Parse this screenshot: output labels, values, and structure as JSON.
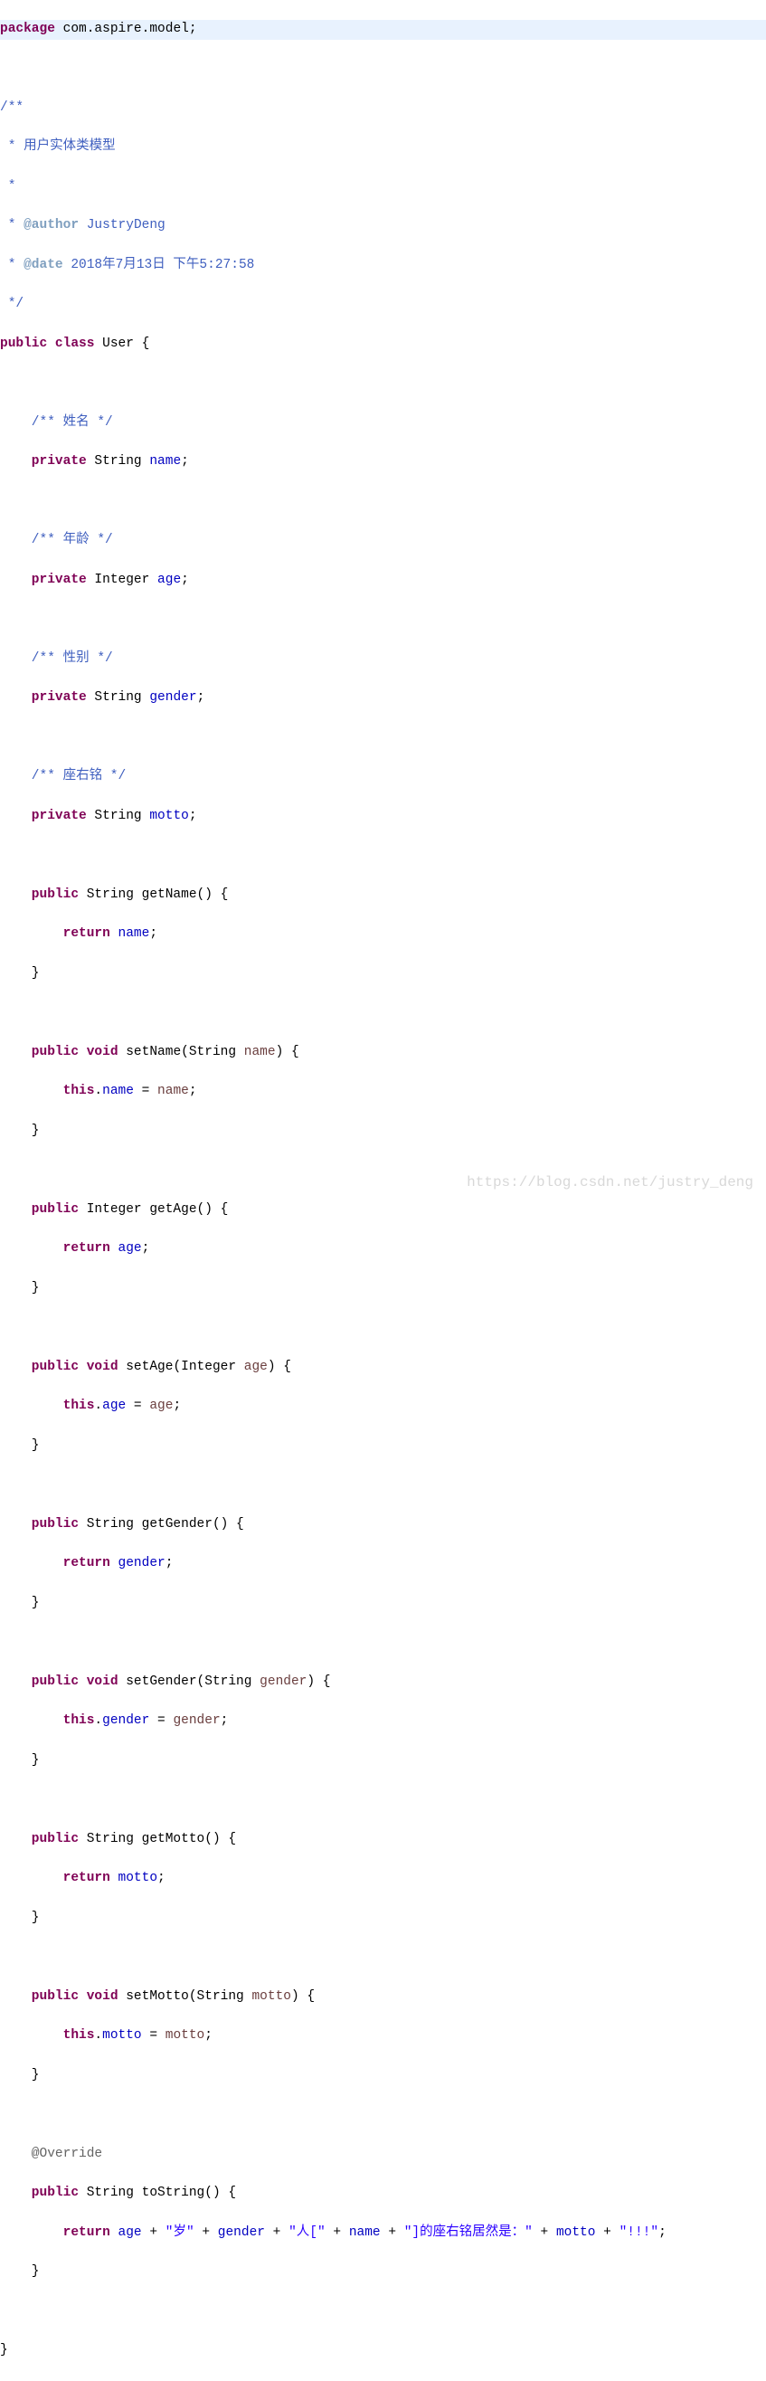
{
  "pkg": {
    "kw": "package",
    "name": " com.aspire.model;"
  },
  "javadoc": {
    "l1": "/**",
    "l2": " * 用户实体类模型",
    "l3": " * ",
    "l4a": " * ",
    "l4tag": "@author",
    "l4b": " JustryDeng",
    "l5a": " * ",
    "l5tag": "@date",
    "l5b": " 2018年7月13日 下午5:27:58",
    "l6": " */"
  },
  "cls": {
    "pub": "public",
    "class": "class",
    "name": " User {"
  },
  "f_name": {
    "c": "    /** 姓名 */",
    "kw": "    private",
    "type": " String ",
    "field": "name",
    "semi": ";"
  },
  "f_age": {
    "c": "    /** 年龄 */",
    "kw": "    private",
    "type": " Integer ",
    "field": "age",
    "semi": ";"
  },
  "f_gender": {
    "c": "    /** 性别 */",
    "kw": "    private",
    "type": " String ",
    "field": "gender",
    "semi": ";"
  },
  "f_motto": {
    "c": "    /** 座右铭 */",
    "kw": "    private",
    "type": " String ",
    "field": "motto",
    "semi": ";"
  },
  "getName": {
    "sig_pub": "    public",
    "sig_rest": " String getName() {",
    "ret_kw": "        return",
    "ret_sp": " ",
    "ret_field": "name",
    "ret_semi": ";",
    "close": "    }"
  },
  "setName": {
    "sig_pub": "    public",
    "sig_void": " void",
    "sig_rest_a": " setName(String ",
    "sig_param": "name",
    "sig_rest_b": ") {",
    "body_this": "        this",
    "body_dot": ".",
    "body_field": "name",
    "body_eq": " = ",
    "body_param": "name",
    "body_semi": ";",
    "close": "    }"
  },
  "getAge": {
    "sig_pub": "    public",
    "sig_rest": " Integer getAge() {",
    "ret_kw": "        return",
    "ret_sp": " ",
    "ret_field": "age",
    "ret_semi": ";",
    "close": "    }"
  },
  "setAge": {
    "sig_pub": "    public",
    "sig_void": " void",
    "sig_rest_a": " setAge(Integer ",
    "sig_param": "age",
    "sig_rest_b": ") {",
    "body_this": "        this",
    "body_dot": ".",
    "body_field": "age",
    "body_eq": " = ",
    "body_param": "age",
    "body_semi": ";",
    "close": "    }"
  },
  "getGender": {
    "sig_pub": "    public",
    "sig_rest": " String getGender() {",
    "ret_kw": "        return",
    "ret_sp": " ",
    "ret_field": "gender",
    "ret_semi": ";",
    "close": "    }"
  },
  "setGender": {
    "sig_pub": "    public",
    "sig_void": " void",
    "sig_rest_a": " setGender(String ",
    "sig_param": "gender",
    "sig_rest_b": ") {",
    "body_this": "        this",
    "body_dot": ".",
    "body_field": "gender",
    "body_eq": " = ",
    "body_param": "gender",
    "body_semi": ";",
    "close": "    }"
  },
  "getMotto": {
    "sig_pub": "    public",
    "sig_rest": " String getMotto() {",
    "ret_kw": "        return",
    "ret_sp": " ",
    "ret_field": "motto",
    "ret_semi": ";",
    "close": "    }"
  },
  "setMotto": {
    "sig_pub": "    public",
    "sig_void": " void",
    "sig_rest_a": " setMotto(String ",
    "sig_param": "motto",
    "sig_rest_b": ") {",
    "body_this": "        this",
    "body_dot": ".",
    "body_field": "motto",
    "body_eq": " = ",
    "body_param": "motto",
    "body_semi": ";",
    "close": "    }"
  },
  "override": "    @Override",
  "toString": {
    "sig_pub": "    public",
    "sig_rest": " String toString() {",
    "ret_kw": "        return",
    "sp": " ",
    "f_age": "age",
    "plus": " + ",
    "s1": "\"岁\"",
    "f_gender": "gender",
    "s2": "\"人[\"",
    "f_name": "name",
    "s3": "\"]的座右铭居然是：\"",
    "f_motto": "motto",
    "s4": "\"!!!\"",
    "semi": ";",
    "close": "    }"
  },
  "classClose": "}",
  "watermark": "https://blog.csdn.net/justry_deng"
}
